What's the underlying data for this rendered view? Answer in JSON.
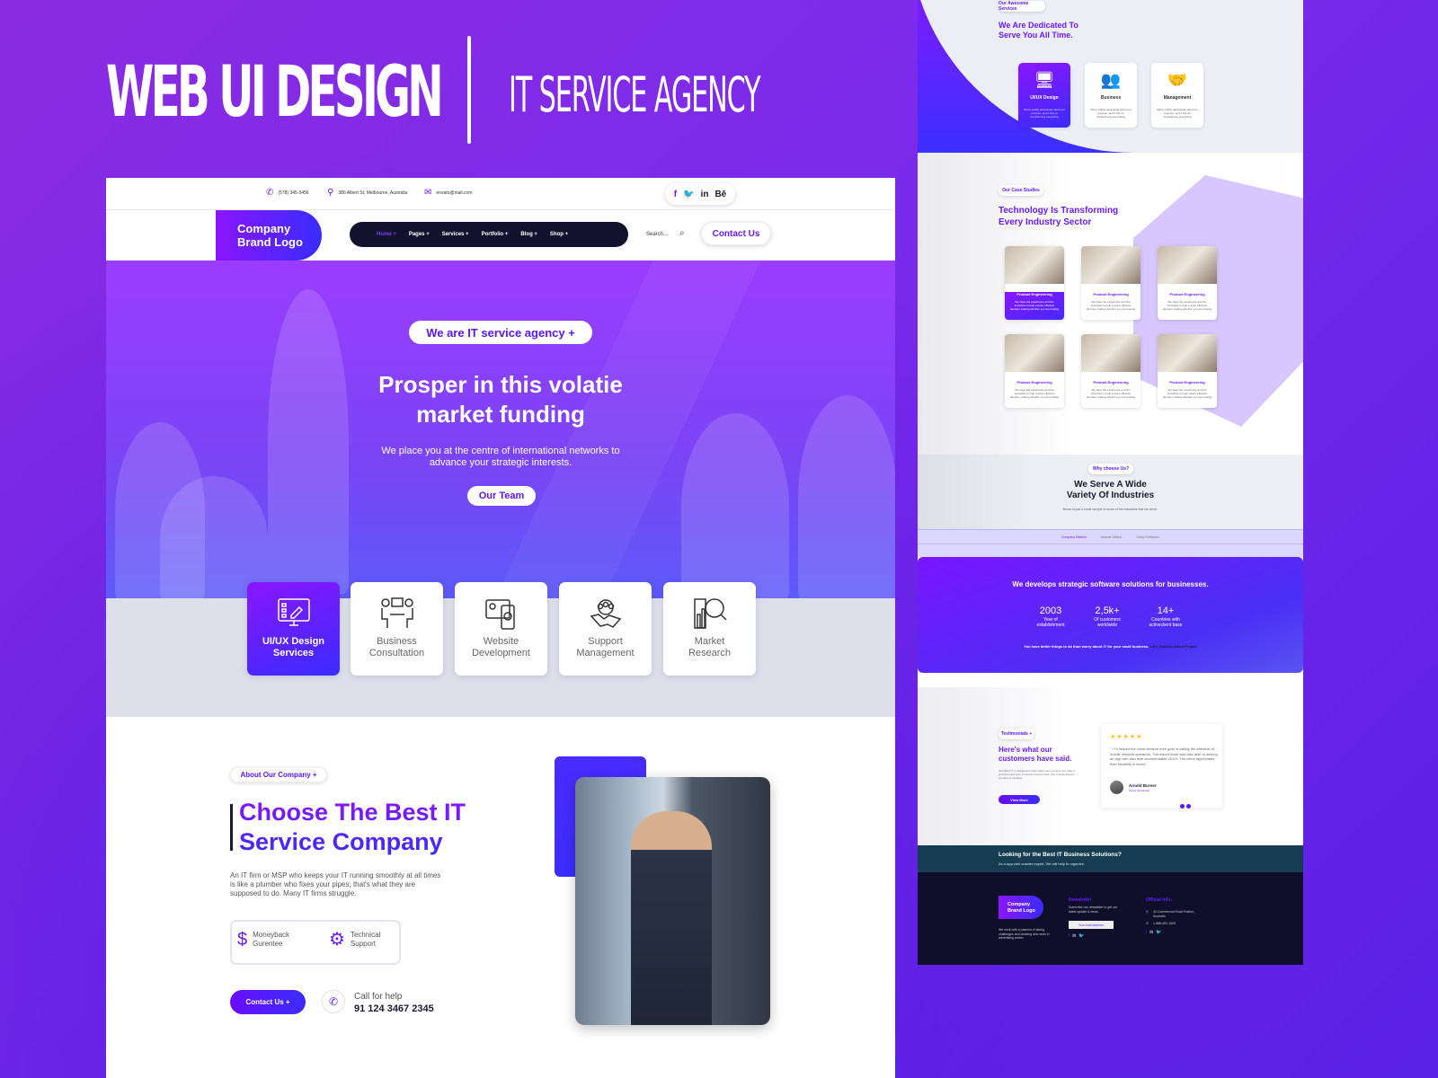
{
  "banner": {
    "title": "WEB UI DESIGN",
    "subtitle": "IT SERVICE AGENCY"
  },
  "topbar": {
    "phone": "(578) 345-3456",
    "address": "380 Albert St, Melbourne, Australia",
    "email": "envato@mail.com",
    "social": [
      "f",
      "🐦",
      "in",
      "Bē"
    ]
  },
  "header": {
    "logo_line1": "Company",
    "logo_line2": "Brand Logo",
    "nav": [
      {
        "label": "Home +",
        "active": true
      },
      {
        "label": "Pages +"
      },
      {
        "label": "Services +"
      },
      {
        "label": "Portfolio +"
      },
      {
        "label": "Blog +"
      },
      {
        "label": "Shop +"
      }
    ],
    "search_placeholder": "Search...",
    "contact_label": "Contact Us"
  },
  "hero": {
    "badge": "We are IT service agency +",
    "title_line1": "Prosper in this volatie",
    "title_line2": "market funding",
    "subtitle_line1": "We place you at the centre of international networks to",
    "subtitle_line2": "advance your strategic interests.",
    "button": "Our Team"
  },
  "services": [
    {
      "line1": "UI/UX Design",
      "line2": "Services",
      "icon": "monitor-pen-icon",
      "active": true
    },
    {
      "line1": "Business",
      "line2": "Consultation",
      "icon": "meeting-icon"
    },
    {
      "line1": "Website",
      "line2": "Development",
      "icon": "web-dev-icon"
    },
    {
      "line1": "Support",
      "line2": "Management",
      "icon": "handshake-icon"
    },
    {
      "line1": "Market",
      "line2": "Research",
      "icon": "magnifier-chart-icon"
    }
  ],
  "about": {
    "badge": "About Our Company  +",
    "title_line1": "Choose The Best IT",
    "title_line2": "Service Company",
    "text": "An IT firm or MSP who keeps your IT running smoothly at all times is like a plumber who fixes your pipes; that's what they are supposed to do. Many IT firms struggle.",
    "features": [
      {
        "line1": "Moneyback",
        "line2": "Gurentee",
        "icon": "money-hand-icon"
      },
      {
        "line1": "Technical",
        "line2": "Support",
        "icon": "support-gear-icon"
      }
    ],
    "contact_button": "Contact Us  +",
    "call_label": "Call for help",
    "call_number": "91 124 3467 2345"
  },
  "right": {
    "services_badge": "Our Awesome Services",
    "services_title_line1": "We Are Dedicated To",
    "services_title_line2": "Serve You All Time.",
    "mini_cards": [
      {
        "title": "UI/UX Design",
        "desc": "We're solidly passionate about our purpose, and it has us transforming everything",
        "active": true
      },
      {
        "title": "Business",
        "desc": "We're solidly passionate about our purpose, and it has us transforming everything"
      },
      {
        "title": "Management",
        "desc": "We're solidly passionate about our purpose, and it has us transforming everything"
      }
    ],
    "cases_badge": "Our Case Studies",
    "cases_title_line1": "Technology Is Transforming",
    "cases_title_line2": "Every Industry Sector",
    "case_cards": [
      {
        "title": "Product Engineering",
        "desc": "We have the experience and the knowhow to help ensure effective decision making whether you are looking",
        "active": true
      },
      {
        "title": "Product Engineering",
        "desc": "We have the experience and the knowhow to help ensure effective decision making whether you are looking"
      },
      {
        "title": "Product Engineering",
        "desc": "We have the experience and the knowhow to help ensure effective decision making whether you are looking"
      },
      {
        "title": "Product Engineering",
        "desc": "We have the experience and the knowhow to help ensure effective decision making whether you are looking"
      },
      {
        "title": "Product Engineering",
        "desc": "We have the experience and the knowhow to help ensure effective decision making whether you are looking"
      },
      {
        "title": "Product Engineering",
        "desc": "We have the experience and the knowhow to help ensure effective decision making whether you are looking"
      }
    ],
    "why_badge": "Why choose Us?",
    "why_title_line1": "We Serve A Wide",
    "why_title_line2": "Variety Of Industries",
    "why_desc": "Below is just a small sample of some of the industries that we serve.",
    "tabs": [
      {
        "label": "Company Mission",
        "active": true
      },
      {
        "label": "Awards Winner"
      },
      {
        "label": "Using Softwares"
      }
    ],
    "stats_title": "We develops strategic software solutions for businesses.",
    "stats": [
      {
        "number": "2003",
        "label_line1": "Year of",
        "label_line2": "establishment"
      },
      {
        "number": "2,5k+",
        "label_line1": "Of customers",
        "label_line2": "worldwide"
      },
      {
        "number": "14+",
        "label_line1": "Countries with",
        "label_line2": "activeclient base"
      }
    ],
    "stats_footer": "You have better things to do than worry about IT for your small business.",
    "stats_link": "Let's Discuss about Project",
    "testimonials_badge": "Testimonials +",
    "testimonials_title_line1": "Here's what our",
    "testimonials_title_line2": "customers have said.",
    "testimonials_text": "Simplified IT is designed to help make sure you and your data is protected and your computer runs it's best. The network Access provides is valuable.",
    "view_more": "View More",
    "rating": 5,
    "quote": "\" I To helped the client achieve their goal of calling the attention of mobile  network operators. The expert team was also able to devcop an app with also with commendable UI/UX. The client appreciates their flexibility in terms\"",
    "reviewer_name": "Arnold Burner",
    "reviewer_role": "Senior Developer",
    "cta_title": "Looking for the Best IT Business Solutions?",
    "cta_sub": "As a app web crawler expert, We will help to organize.",
    "footer": {
      "logo_line1": "Company",
      "logo_line2": "Brand Logo",
      "about": "We work with a passion of taking challenges and creating new ones in advertising sector.",
      "newsletter_title": "Newsletter",
      "newsletter_text": "Subscribe our newsletter to get our latest update & news.",
      "email_placeholder": "Your mail address",
      "info_title": "Official info:",
      "info_address": "30 Commercial Road Fratton, Australia",
      "info_phone": "1-888-452-1505"
    }
  },
  "colors": {
    "primary": "#6a1bff",
    "secondary": "#3a2cff",
    "dark": "#13122e",
    "footer": "#0f0e2b",
    "cta": "#163d52"
  }
}
